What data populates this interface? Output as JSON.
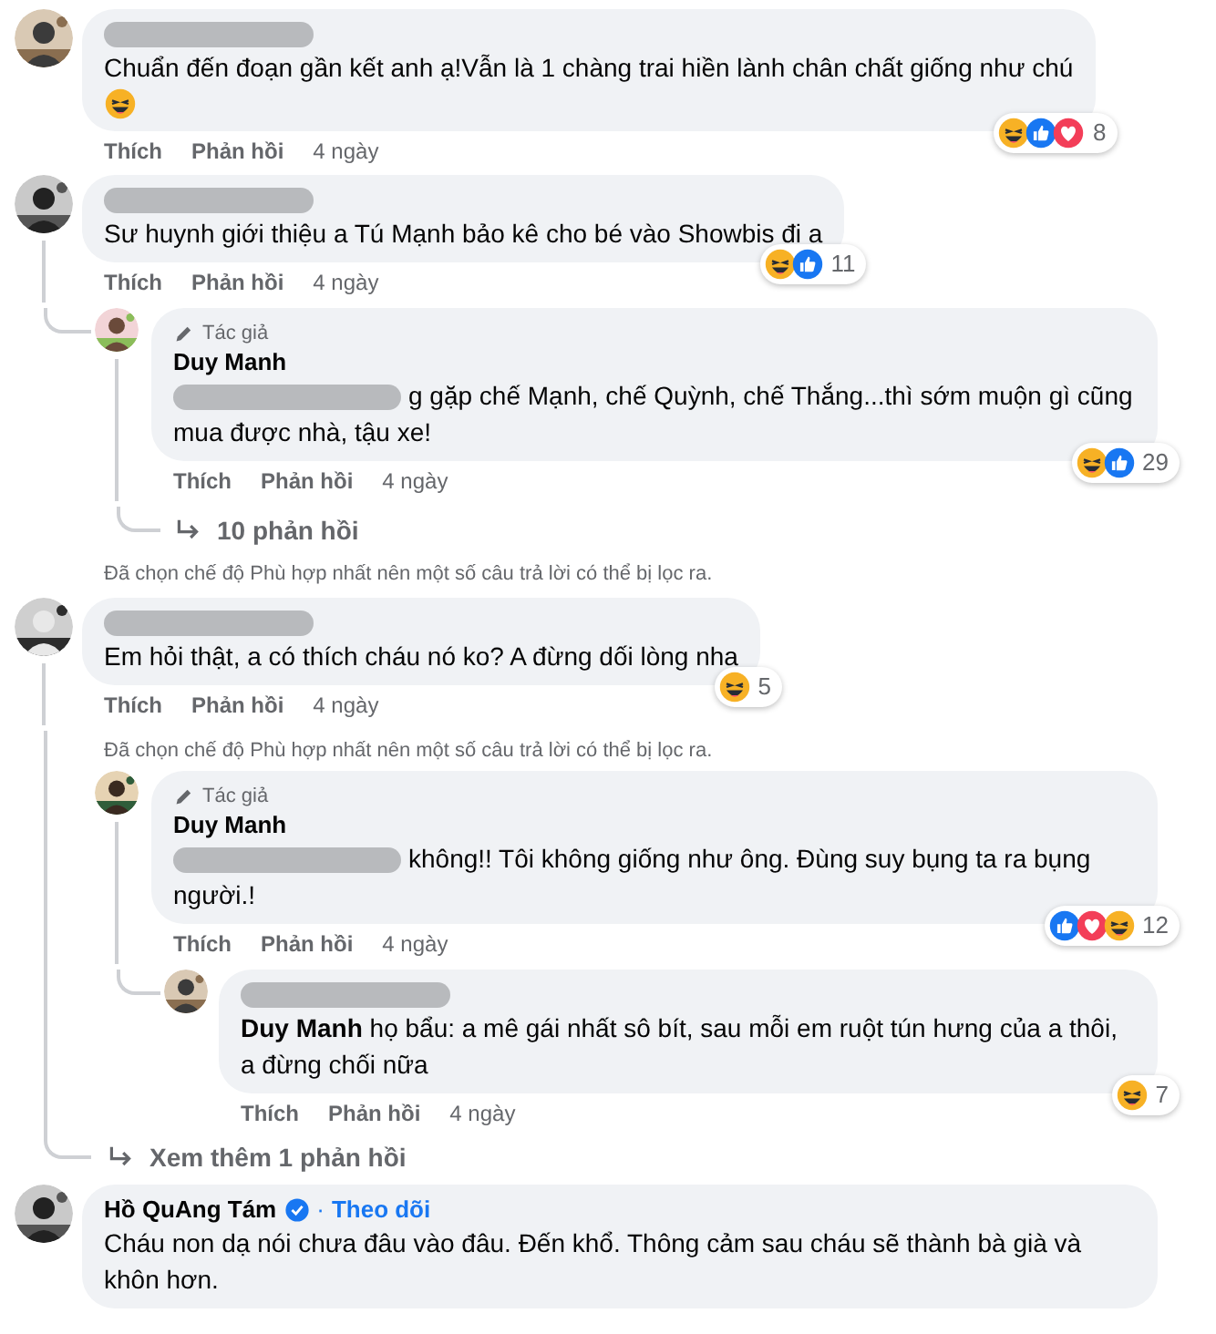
{
  "comments": [
    {
      "avatar": {
        "kind": "picture"
      },
      "name_redacted": true,
      "text": "Chuẩn đến đoạn gần kết anh ạ!Vẫn là 1 chàng trai hiền lành chân chất giống như chú",
      "trailing_emoji": {
        "kind": "haha"
      },
      "reactions": {
        "icons": [
          {
            "kind": "haha"
          },
          {
            "kind": "like"
          },
          {
            "kind": "love"
          }
        ],
        "count": "8"
      },
      "actions": [
        "Thích",
        "Phản hồi"
      ],
      "time": "4 ngày"
    },
    {
      "avatar": {
        "kind": "picture"
      },
      "name_redacted": true,
      "text": "Sư huynh giới thiệu a Tú Mạnh bảo kê cho bé vào Showbis đi a",
      "reactions": {
        "icons": [
          {
            "kind": "haha"
          },
          {
            "kind": "like"
          }
        ],
        "count": "11"
      },
      "actions": [
        "Thích",
        "Phản hồi"
      ],
      "time": "4 ngày",
      "children": [
        {
          "kind": "reply",
          "avatar": {
            "kind": "picture"
          },
          "author_badge": "Tác giả",
          "name": "Duy Manh",
          "redacted_lead": true,
          "text": "g gặp chế Mạnh, chế Quỳnh, chế Thắng...thì sớm muộn gì cũng mua được nhà, tậu xe!",
          "reactions": {
            "icons": [
              {
                "kind": "haha"
              },
              {
                "kind": "like"
              }
            ],
            "count": "29"
          },
          "actions": [
            "Thích",
            "Phản hồi"
          ],
          "time": "4 ngày",
          "children": [
            {
              "kind": "more",
              "label": "10 phản hồi"
            }
          ]
        },
        {
          "kind": "note",
          "text": "Đã chọn chế độ Phù hợp nhất nên một số câu trả lời có thể bị lọc ra."
        }
      ]
    },
    {
      "avatar": {
        "kind": "picture"
      },
      "name_redacted": true,
      "text": "Em hỏi thật, a có thích cháu nó ko? A đừng dối lòng nha",
      "reactions": {
        "icons": [
          {
            "kind": "haha"
          }
        ],
        "count": "5"
      },
      "actions": [
        "Thích",
        "Phản hồi"
      ],
      "time": "4 ngày",
      "children": [
        {
          "kind": "note",
          "text": "Đã chọn chế độ Phù hợp nhất nên một số câu trả lời có thể bị lọc ra."
        },
        {
          "kind": "reply",
          "avatar": {
            "kind": "picture"
          },
          "author_badge": "Tác giả",
          "name": "Duy Manh",
          "redacted_lead": true,
          "text": "không!! Tôi không giống như ông. Đùng suy bụng ta ra bụng người.!",
          "reactions": {
            "icons": [
              {
                "kind": "like"
              },
              {
                "kind": "love"
              },
              {
                "kind": "haha"
              }
            ],
            "count": "12"
          },
          "actions": [
            "Thích",
            "Phản hồi"
          ],
          "time": "4 ngày",
          "children": [
            {
              "kind": "reply",
              "avatar": {
                "kind": "picture"
              },
              "name_redacted": true,
              "text": "**Duy Manh** họ bẩu: a mê gái nhất sô bít, sau mỗi em ruột tún hưng của a thôi, a đừng chối nữa",
              "reactions": {
                "icons": [
                  {
                    "kind": "haha"
                  }
                ],
                "count": "7"
              },
              "actions": [
                "Thích",
                "Phản hồi"
              ],
              "time": "4 ngày"
            }
          ]
        },
        {
          "kind": "more",
          "label": "Xem thêm 1 phản hồi"
        }
      ]
    },
    {
      "avatar": {
        "kind": "picture"
      },
      "name": "Hồ QuAng Tám",
      "verified": true,
      "separator": "·",
      "follow": "Theo dõi",
      "text": "Cháu non dạ nói chưa đâu vào đâu. Đến khổ. Thông cảm sau cháu sẽ thành bà già và khôn hơn."
    }
  ]
}
